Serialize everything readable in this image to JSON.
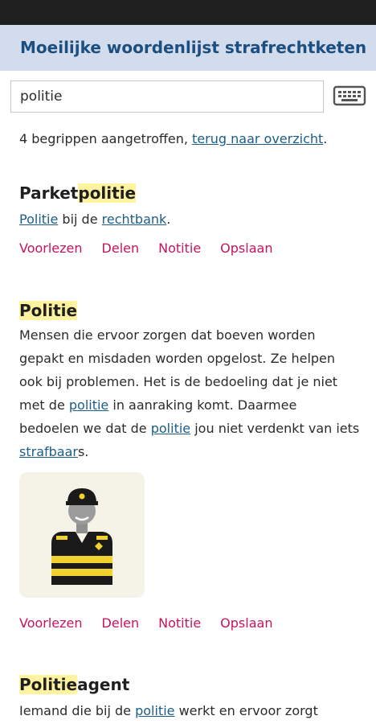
{
  "app": {
    "title": "Moeilijke woordenlijst strafrechtketen"
  },
  "search": {
    "value": "politie"
  },
  "summary": {
    "text": "4 begrippen aangetroffen, ",
    "link": "terug naar overzicht",
    "suffix": "."
  },
  "actions": {
    "read": "Voorlezen",
    "share": "Delen",
    "note": "Notitie",
    "save": "Opslaan"
  },
  "entries": [
    {
      "title_pre": "Parket",
      "title_hl": "politie",
      "title_post": "",
      "definition": {
        "link1": "Politie",
        "t1": " bij de ",
        "link2": "rechtbank",
        "t2": "."
      }
    },
    {
      "title_pre": "",
      "title_hl": "Politie",
      "title_post": "",
      "definition": {
        "t1": "Mensen die ervoor zorgen dat boeven worden gepakt en misdaden worden opgelost. Ze helpen ook bij problemen. Het is de bedoeling dat je niet met de ",
        "link1": "politie",
        "t2": " in aanraking komt. Daarmee bedoelen we dat de ",
        "link2": "politie",
        "t3": " jou niet verdenkt van iets ",
        "link3": "strafbaar",
        "t4": "s."
      }
    },
    {
      "title_pre": "",
      "title_hl": "Politie",
      "title_post": "agent",
      "definition": {
        "t1": "Iemand die bij de ",
        "link1": "politie",
        "t2": " werkt en ervoor zorgt"
      }
    }
  ],
  "colors": {
    "header_bg": "#d3dcec",
    "title": "#1c4e80",
    "link": "#1c5d87",
    "action": "#c4135f",
    "highlight": "#fff3a0"
  },
  "icons": {
    "keyboard": "keyboard-icon",
    "illustration": "police-officer-illustration"
  }
}
